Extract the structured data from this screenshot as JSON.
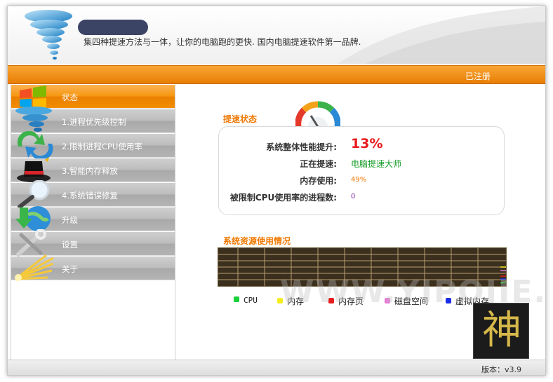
{
  "header": {
    "slogan": "集四种提速方法与一体，让你的电脑跑的更快. 国内电脑提速软件第一品牌."
  },
  "top_bar": {
    "registered": "已注册"
  },
  "sidebar": {
    "items": [
      {
        "label": "状态",
        "icon": "windows-flag-icon",
        "active": true
      },
      {
        "label": "1.进程优先级控制",
        "icon": "tornado-icon",
        "active": false
      },
      {
        "label": "2.限制进程CPU使用率",
        "icon": "refresh-arrows-icon",
        "active": false
      },
      {
        "label": "3.智能内存释放",
        "icon": "magic-hat-icon",
        "active": false
      },
      {
        "label": "4.系统错误修复",
        "icon": "magnifier-icon",
        "active": false
      },
      {
        "label": "升级",
        "icon": "globe-download-icon",
        "active": false
      },
      {
        "label": "设置",
        "icon": "tools-icon",
        "active": false
      },
      {
        "label": "关于",
        "icon": "light-burst-icon",
        "active": false
      }
    ]
  },
  "status": {
    "title": "提速状态",
    "rows": [
      {
        "label": "系统整体性能提升:",
        "value": "13%"
      },
      {
        "label": "正在提速:",
        "value": "电脑提速大师"
      },
      {
        "label": "内存使用:",
        "value": "49%"
      },
      {
        "label": "被限制CPU使用率的进程数:",
        "value": "0"
      }
    ]
  },
  "resources": {
    "title": "系统资源使用情况",
    "legend": [
      {
        "label": "CPU",
        "color": "#19d13a"
      },
      {
        "label": "内存",
        "color": "#f4ee1e"
      },
      {
        "label": "内存页",
        "color": "#e81b1b"
      },
      {
        "label": "磁盘空间",
        "color": "#e87ad6"
      },
      {
        "label": "虚拟内存",
        "color": "#1b2de8"
      }
    ]
  },
  "watermark": "WWW.YIPOJIE.CN",
  "badge": {
    "glyph": "神"
  },
  "footer": {
    "version": "版本：v3.9"
  },
  "colors": {
    "accent": "#f08a0c",
    "section_title": "#f07800"
  }
}
